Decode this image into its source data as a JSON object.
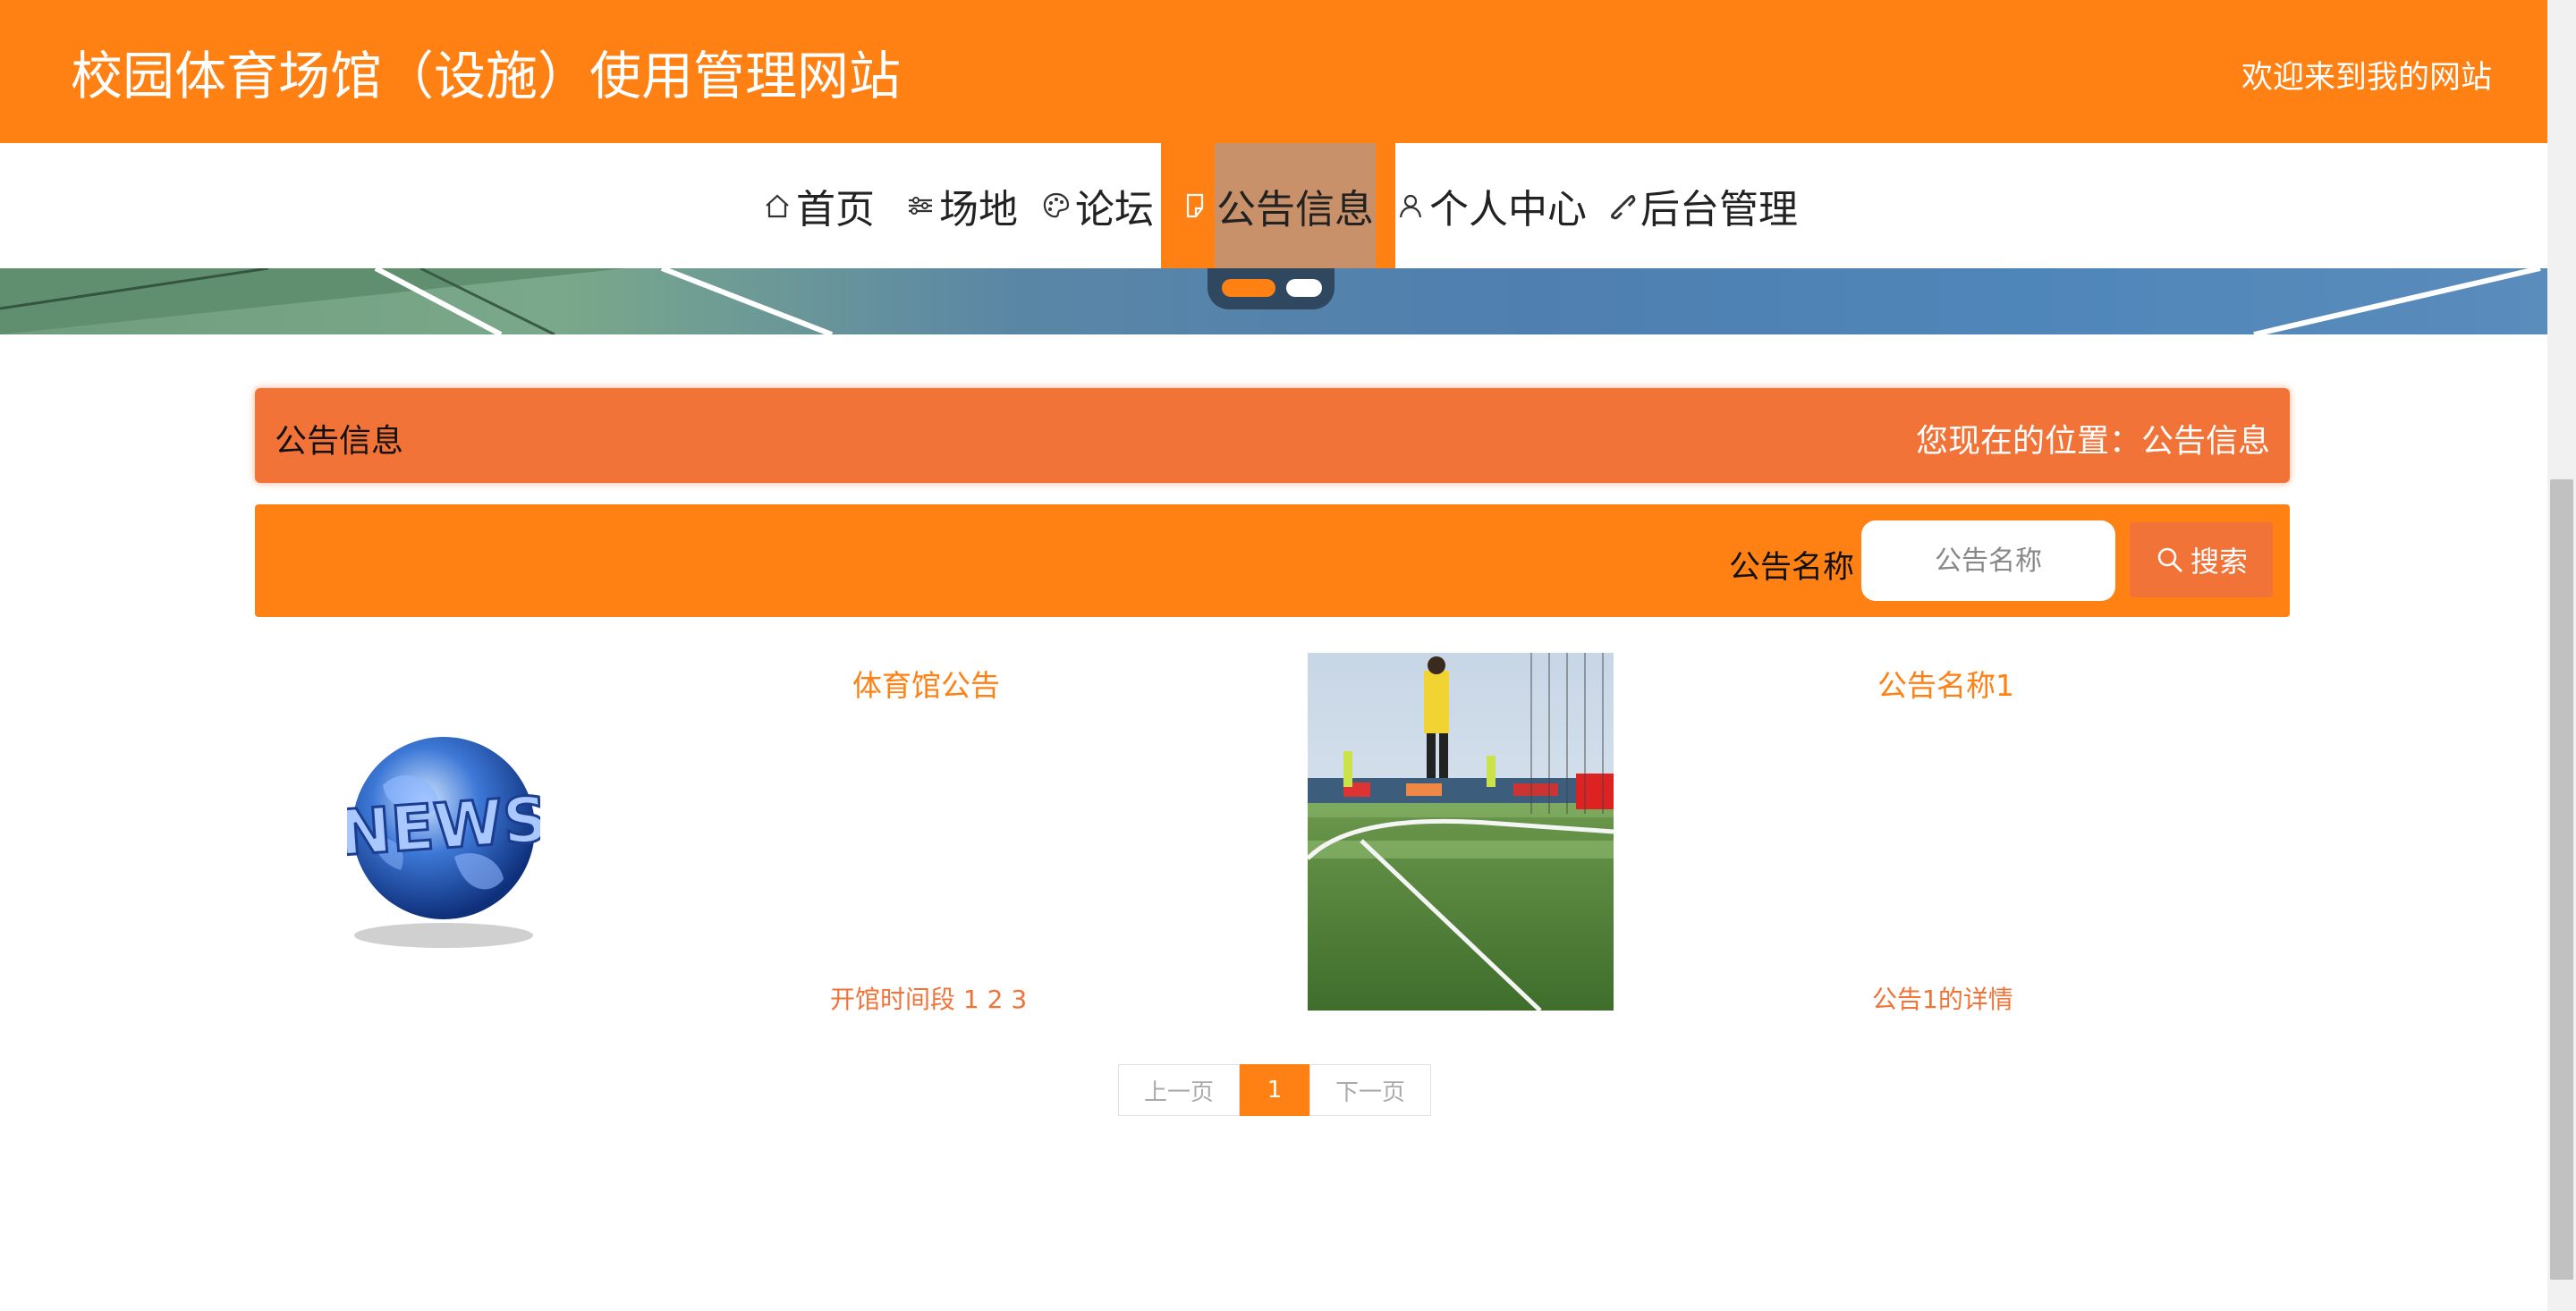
{
  "header": {
    "site_title": "校园体育场馆（设施）使用管理网站",
    "welcome": "欢迎来到我的网站"
  },
  "nav": {
    "items": [
      {
        "label": "首页",
        "icon": "home-icon"
      },
      {
        "label": "场地",
        "icon": "sliders-icon"
      },
      {
        "label": "论坛",
        "icon": "palette-icon"
      },
      {
        "label": "公告信息",
        "icon": "note-icon",
        "active": true
      },
      {
        "label": "个人中心",
        "icon": "user-icon"
      },
      {
        "label": "后台管理",
        "icon": "link-icon"
      }
    ]
  },
  "carousel": {
    "slides": 2,
    "active_index": 0
  },
  "title_bar": {
    "title": "公告信息",
    "breadcrumb": "您现在的位置：公告信息"
  },
  "search": {
    "label": "公告名称",
    "placeholder": "公告名称",
    "value": "",
    "button_label": "搜索"
  },
  "announcements": [
    {
      "title": "体育馆公告",
      "desc": "开馆时间段 1 2 3",
      "image": "news-globe"
    },
    {
      "title": "公告名称1",
      "desc": "公告1的详情",
      "image": "soccer-field-photo"
    }
  ],
  "pagination": {
    "prev_label": "上一页",
    "current": "1",
    "next_label": "下一页"
  },
  "colors": {
    "primary": "#ff8013",
    "secondary": "#f27338"
  }
}
